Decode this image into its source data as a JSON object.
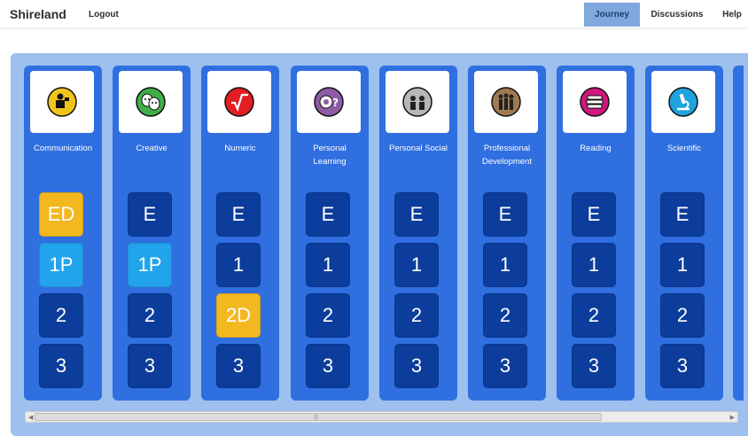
{
  "header": {
    "brand": "Shireland",
    "logout": "Logout",
    "nav": [
      {
        "label": "Journey",
        "active": true
      },
      {
        "label": "Discussions",
        "active": false
      },
      {
        "label": "Help",
        "active": false
      }
    ]
  },
  "columns": [
    {
      "label_lines": [
        "Communication"
      ],
      "icon": "communication-icon",
      "icon_color": "#f2c31b",
      "tiles": [
        {
          "text": "ED",
          "state": "gold"
        },
        {
          "text": "1P",
          "state": "sky"
        },
        {
          "text": "2",
          "state": "dark"
        },
        {
          "text": "3",
          "state": "dark"
        }
      ]
    },
    {
      "label_lines": [
        "Creative"
      ],
      "icon": "creative-masks-icon",
      "icon_color": "#3fae49",
      "tiles": [
        {
          "text": "E",
          "state": "dark"
        },
        {
          "text": "1P",
          "state": "sky"
        },
        {
          "text": "2",
          "state": "dark"
        },
        {
          "text": "3",
          "state": "dark"
        }
      ]
    },
    {
      "label_lines": [
        "Numeric"
      ],
      "icon": "numeric-sqrt-icon",
      "icon_color": "#e21d24",
      "tiles": [
        {
          "text": "E",
          "state": "dark"
        },
        {
          "text": "1",
          "state": "dark"
        },
        {
          "text": "2D",
          "state": "gold"
        },
        {
          "text": "3",
          "state": "dark"
        }
      ]
    },
    {
      "label_lines": [
        "Personal",
        "Learning"
      ],
      "icon": "personal-learning-icon",
      "icon_color": "#8e5aa6",
      "tiles": [
        {
          "text": "E",
          "state": "dark"
        },
        {
          "text": "1",
          "state": "dark"
        },
        {
          "text": "2",
          "state": "dark"
        },
        {
          "text": "3",
          "state": "dark"
        }
      ]
    },
    {
      "label_lines": [
        "Personal Social"
      ],
      "icon": "personal-social-icon",
      "icon_color": "#b7b7b7",
      "tiles": [
        {
          "text": "E",
          "state": "dark"
        },
        {
          "text": "1",
          "state": "dark"
        },
        {
          "text": "2",
          "state": "dark"
        },
        {
          "text": "3",
          "state": "dark"
        }
      ]
    },
    {
      "label_lines": [
        "Professional",
        "Development"
      ],
      "icon": "professional-development-icon",
      "icon_color": "#a07a52",
      "tiles": [
        {
          "text": "E",
          "state": "dark"
        },
        {
          "text": "1",
          "state": "dark"
        },
        {
          "text": "2",
          "state": "dark"
        },
        {
          "text": "3",
          "state": "dark"
        }
      ]
    },
    {
      "label_lines": [
        "Reading"
      ],
      "icon": "reading-books-icon",
      "icon_color": "#d1177d",
      "tiles": [
        {
          "text": "E",
          "state": "dark"
        },
        {
          "text": "1",
          "state": "dark"
        },
        {
          "text": "2",
          "state": "dark"
        },
        {
          "text": "3",
          "state": "dark"
        }
      ]
    },
    {
      "label_lines": [
        "Scientific"
      ],
      "icon": "scientific-microscope-icon",
      "icon_color": "#1ea3dc",
      "tiles": [
        {
          "text": "E",
          "state": "dark"
        },
        {
          "text": "1",
          "state": "dark"
        },
        {
          "text": "2",
          "state": "dark"
        },
        {
          "text": "3",
          "state": "dark"
        }
      ]
    }
  ],
  "colors": {
    "column_bg": "#2f6fe0",
    "tile_dark": "#0c3d9c",
    "tile_gold": "#f3b81f",
    "tile_sky": "#22a4ec",
    "panel_bg": "#9dc0ef",
    "nav_active": "#7fa8dd"
  }
}
